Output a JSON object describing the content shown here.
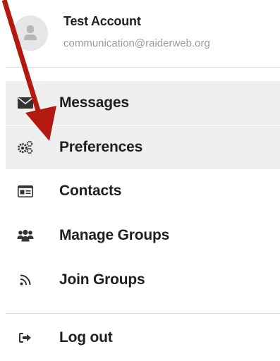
{
  "account": {
    "name": "Test Account",
    "email": "communication@raiderweb.org"
  },
  "menu": {
    "items": [
      {
        "label": "Messages",
        "icon": "envelope-icon"
      },
      {
        "label": "Preferences",
        "icon": "cogs-icon"
      },
      {
        "label": "Contacts",
        "icon": "address-card-icon"
      },
      {
        "label": "Manage Groups",
        "icon": "users-icon"
      },
      {
        "label": "Join Groups",
        "icon": "rss-icon"
      },
      {
        "label": "Log out",
        "icon": "sign-out-icon"
      }
    ]
  },
  "colors": {
    "annotation_arrow": "#b4190f",
    "active_background": "#efefef",
    "icon": "#333333"
  }
}
